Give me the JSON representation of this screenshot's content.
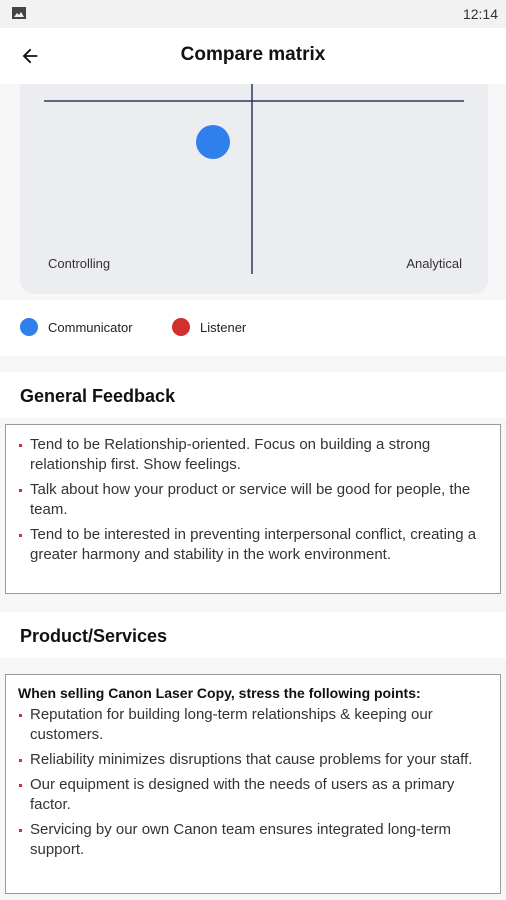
{
  "status_bar": {
    "time": "12:14",
    "image_icon": "image-icon"
  },
  "app_bar": {
    "title": "Compare matrix",
    "back_icon": "arrow-back-icon"
  },
  "matrix": {
    "left_label": "Controlling",
    "right_label": "Analytical",
    "point_color": "#2f80ed",
    "axis_color": "#2e3a59"
  },
  "legend": [
    {
      "label": "Communicator",
      "color": "#2f80ed"
    },
    {
      "label": "Listener",
      "color": "#d32f2f"
    }
  ],
  "general_feedback": {
    "title": "General Feedback",
    "items": [
      "Tend to be Relationship-oriented. Focus on building a strong relationship first. Show feelings.",
      "Talk about how your product or service will be good for people, the team.",
      "Tend to be interested in preventing interpersonal conflict, creating a greater harmony and stability in the work environment."
    ]
  },
  "product_services": {
    "title": "Product/Services",
    "heading": "When selling Canon Laser Copy, stress the following points:",
    "items": [
      "Reputation for building long-term relationships & keeping our customers.",
      "Reliability minimizes disruptions that cause problems for your staff.",
      "Our equipment is designed with the needs of users as a primary factor.",
      "Servicing by our own Canon team ensures integrated long-term support."
    ]
  }
}
